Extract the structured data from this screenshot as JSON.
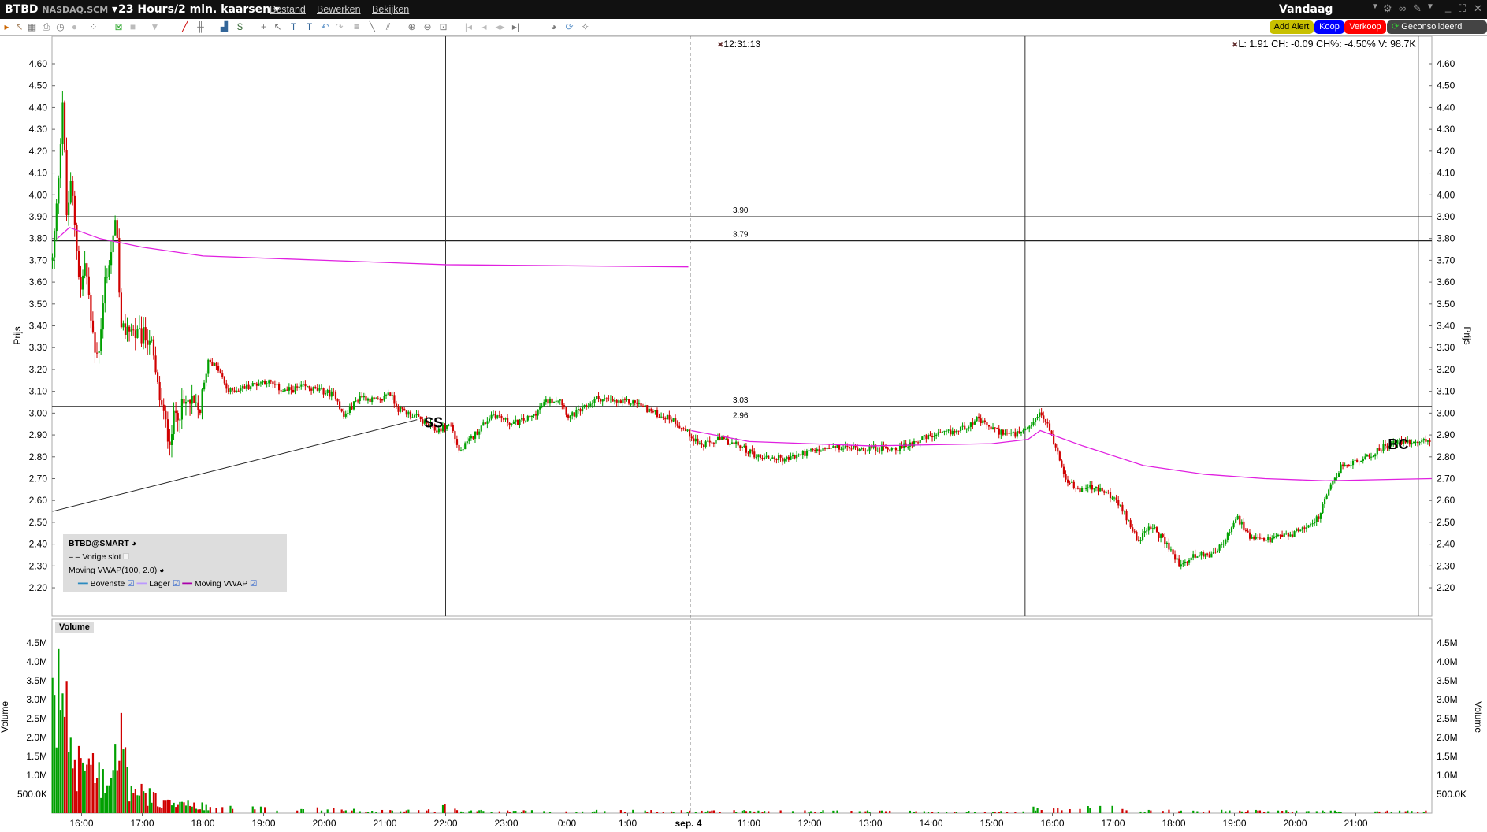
{
  "topbar": {
    "symbol": "BTBD",
    "exchange": "NASDAQ.SCM",
    "period": "23 Hours/2 min. kaarsen",
    "menu": [
      "Bestand",
      "Bewerken",
      "Bekijken"
    ],
    "range": "Vandaag"
  },
  "buttons": {
    "add_alert": "Add Alert",
    "buy": "Koop",
    "sell": "Verkoop",
    "consolidated": "Geconsolideerd"
  },
  "colors": {
    "up": "#00a000",
    "down": "#d00000",
    "vwap": "#e020e0",
    "add_alert": "#c8c000",
    "buy": "#0000ff",
    "sell": "#ff0000"
  },
  "crosshair_time": "12:31:13",
  "info": "L: 1.91 CH: -0.09 CH%: -4.50% V: 98.7K",
  "legend": {
    "title": "BTBD@SMART",
    "prev_close": "Vorige slot",
    "study": "Moving VWAP(100, 2.0)",
    "upper": "Bovenste",
    "lower": "Lager",
    "vwap": "Moving VWAP"
  },
  "volume_label": "Volume",
  "chart_data": {
    "type": "candlestick",
    "ylabel": "Prijs",
    "ylim": [
      2.15,
      4.68
    ],
    "yticks": [
      "4.60",
      "4.50",
      "4.40",
      "4.30",
      "4.20",
      "4.10",
      "4.00",
      "3.90",
      "3.80",
      "3.70",
      "3.60",
      "3.50",
      "3.40",
      "3.30",
      "3.20",
      "3.10",
      "3.00",
      "2.90",
      "2.80",
      "2.70",
      "2.60",
      "2.50",
      "2.40",
      "2.30",
      "2.20"
    ],
    "xticks": [
      "16:00",
      "17:00",
      "18:00",
      "19:00",
      "20:00",
      "21:00",
      "22:00",
      "23:00",
      "0:00",
      "1:00",
      "sep. 4",
      "11:00",
      "12:00",
      "13:00",
      "14:00",
      "15:00",
      "16:00",
      "17:00",
      "18:00",
      "19:00",
      "20:00",
      "21:00"
    ],
    "x_unit": "axis hours from first 16:00 tick",
    "xlim": [
      -0.48,
      22.25
    ],
    "price_path": [
      [
        -0.48,
        3.7
      ],
      [
        -0.41,
        3.95
      ],
      [
        -0.31,
        4.45
      ],
      [
        -0.25,
        3.9
      ],
      [
        -0.17,
        4.05
      ],
      [
        -0.09,
        3.8
      ],
      [
        -0.02,
        3.55
      ],
      [
        0.06,
        3.7
      ],
      [
        0.14,
        3.45
      ],
      [
        0.22,
        3.3
      ],
      [
        0.3,
        3.3
      ],
      [
        0.38,
        3.6
      ],
      [
        0.5,
        3.75
      ],
      [
        0.58,
        3.9
      ],
      [
        0.64,
        3.35
      ],
      [
        0.77,
        3.4
      ],
      [
        0.92,
        3.35
      ],
      [
        1.13,
        3.35
      ],
      [
        1.23,
        3.15
      ],
      [
        1.34,
        3.0
      ],
      [
        1.44,
        2.88
      ],
      [
        1.55,
        3.0
      ],
      [
        1.78,
        3.05
      ],
      [
        1.94,
        3.0
      ],
      [
        2.09,
        3.25
      ],
      [
        2.25,
        3.2
      ],
      [
        2.41,
        3.1
      ],
      [
        2.72,
        3.12
      ],
      [
        3.03,
        3.15
      ],
      [
        3.34,
        3.1
      ],
      [
        3.66,
        3.12
      ],
      [
        3.97,
        3.1
      ],
      [
        4.2,
        3.08
      ],
      [
        4.31,
        2.98
      ],
      [
        4.59,
        3.08
      ],
      [
        4.91,
        3.05
      ],
      [
        5.06,
        3.1
      ],
      [
        5.22,
        3.02
      ],
      [
        5.53,
        2.98
      ],
      [
        5.84,
        2.92
      ],
      [
        6.08,
        2.95
      ],
      [
        6.23,
        2.82
      ],
      [
        6.47,
        2.9
      ],
      [
        6.78,
        3.0
      ],
      [
        7.09,
        2.95
      ],
      [
        7.41,
        2.98
      ],
      [
        7.64,
        3.05
      ],
      [
        7.88,
        3.07
      ],
      [
        8.03,
        2.98
      ],
      [
        8.27,
        3.02
      ],
      [
        8.5,
        3.07
      ],
      [
        8.81,
        3.05
      ],
      [
        9.13,
        3.05
      ],
      [
        9.44,
        3.0
      ],
      [
        9.75,
        2.97
      ],
      [
        10.03,
        2.9
      ],
      [
        10.22,
        2.85
      ],
      [
        10.53,
        2.88
      ],
      [
        10.84,
        2.85
      ],
      [
        11.16,
        2.8
      ],
      [
        11.63,
        2.79
      ],
      [
        11.94,
        2.82
      ],
      [
        12.41,
        2.84
      ],
      [
        13.03,
        2.84
      ],
      [
        13.5,
        2.84
      ],
      [
        13.81,
        2.88
      ],
      [
        14.13,
        2.9
      ],
      [
        14.44,
        2.92
      ],
      [
        14.75,
        2.97
      ],
      [
        15.06,
        2.92
      ],
      [
        15.38,
        2.9
      ],
      [
        15.61,
        2.92
      ],
      [
        15.77,
        3.0
      ],
      [
        15.92,
        2.95
      ],
      [
        16.08,
        2.82
      ],
      [
        16.23,
        2.7
      ],
      [
        16.39,
        2.65
      ],
      [
        16.63,
        2.66
      ],
      [
        16.94,
        2.63
      ],
      [
        17.17,
        2.55
      ],
      [
        17.41,
        2.42
      ],
      [
        17.64,
        2.48
      ],
      [
        17.88,
        2.4
      ],
      [
        18.11,
        2.3
      ],
      [
        18.34,
        2.35
      ],
      [
        18.58,
        2.35
      ],
      [
        18.81,
        2.4
      ],
      [
        19.05,
        2.52
      ],
      [
        19.28,
        2.42
      ],
      [
        19.59,
        2.42
      ],
      [
        19.98,
        2.45
      ],
      [
        20.38,
        2.52
      ],
      [
        20.61,
        2.68
      ],
      [
        20.77,
        2.76
      ],
      [
        21.16,
        2.79
      ],
      [
        21.47,
        2.85
      ],
      [
        21.78,
        2.87
      ],
      [
        22.09,
        2.87
      ],
      [
        22.25,
        2.88
      ]
    ],
    "vwap_day1": [
      [
        -0.4,
        3.8
      ],
      [
        -0.2,
        3.85
      ],
      [
        0.3,
        3.8
      ],
      [
        1,
        3.76
      ],
      [
        2,
        3.72
      ],
      [
        4,
        3.7
      ],
      [
        6,
        3.68
      ],
      [
        10,
        3.67
      ]
    ],
    "vwap_day2": [
      [
        10.05,
        2.92
      ],
      [
        11,
        2.87
      ],
      [
        13,
        2.85
      ],
      [
        15,
        2.86
      ],
      [
        15.6,
        2.88
      ],
      [
        15.8,
        2.92
      ],
      [
        16.5,
        2.85
      ],
      [
        17.5,
        2.76
      ],
      [
        18.5,
        2.72
      ],
      [
        19.5,
        2.7
      ],
      [
        20.5,
        2.69
      ],
      [
        22.25,
        2.7
      ]
    ],
    "hlines": [
      {
        "label": "3.90",
        "value": 3.9
      },
      {
        "label": "3.79",
        "value": 3.79
      },
      {
        "label": "3.03",
        "value": 3.03
      },
      {
        "label": "2.96",
        "value": 2.96
      }
    ],
    "vlines": [
      {
        "t": 6.0,
        "style": "solid"
      },
      {
        "t": 10.03,
        "style": "dashed"
      },
      {
        "t": 15.55,
        "style": "solid"
      },
      {
        "t": 22.03,
        "style": "solid"
      }
    ],
    "trendline": [
      [
        -0.48,
        2.55
      ],
      [
        5.53,
        2.97
      ]
    ],
    "markers": [
      {
        "label": "SS",
        "t": 5.8,
        "price": 2.96
      },
      {
        "label": "BC",
        "t": 21.7,
        "price": 2.86
      }
    ],
    "volume": {
      "yticks": [
        "4.5M",
        "4.0M",
        "3.5M",
        "3.0M",
        "2.5M",
        "2.0M",
        "1.5M",
        "1.0M",
        "500.0K"
      ],
      "ymax_m": 4.75,
      "envelope_m": [
        [
          -0.48,
          3.0
        ],
        [
          -0.3,
          4.8
        ],
        [
          -0.2,
          2.5
        ],
        [
          0,
          1.5
        ],
        [
          0.5,
          1.2
        ],
        [
          0.6,
          3.0
        ],
        [
          0.8,
          0.8
        ],
        [
          1.5,
          0.3
        ],
        [
          3,
          0.15
        ],
        [
          5.9,
          0.1
        ],
        [
          6.0,
          0.35
        ],
        [
          6.2,
          0.08
        ],
        [
          15.5,
          0.06
        ],
        [
          15.6,
          0.2
        ],
        [
          15.8,
          0.08
        ],
        [
          17,
          0.25
        ],
        [
          17.2,
          0.08
        ],
        [
          22.25,
          0.06
        ]
      ]
    }
  }
}
